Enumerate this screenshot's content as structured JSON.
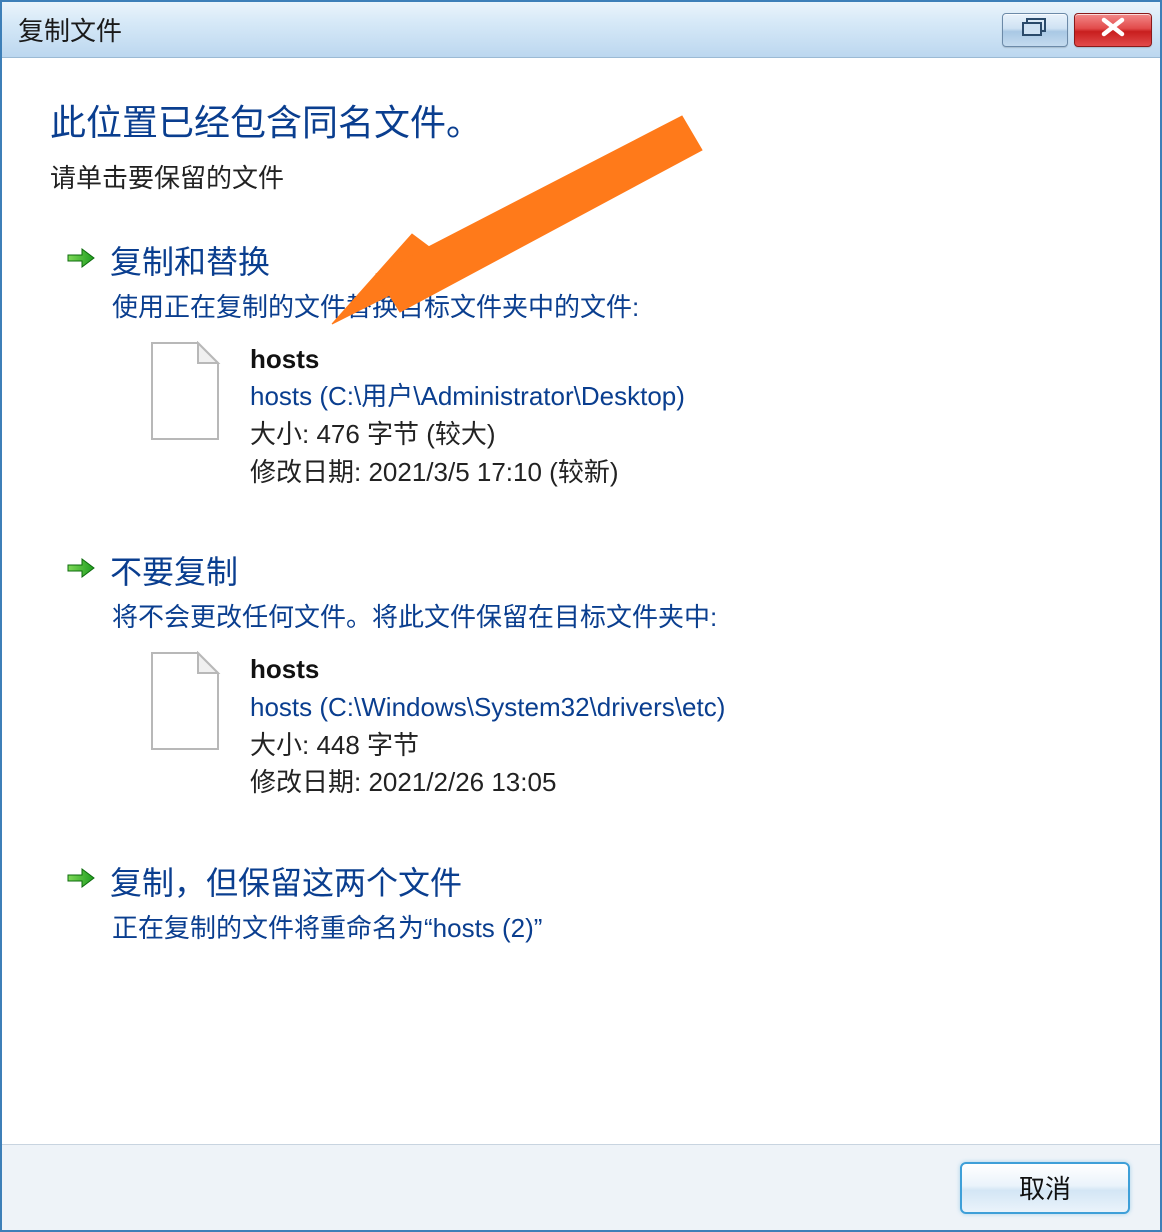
{
  "window": {
    "title": "复制文件"
  },
  "heading": "此位置已经包含同名文件。",
  "subheading": "请单击要保留的文件",
  "options": {
    "replace": {
      "title": "复制和替换",
      "desc": "使用正在复制的文件替换目标文件夹中的文件:",
      "file": {
        "name": "hosts",
        "path": "hosts (C:\\用户\\Administrator\\Desktop)",
        "size": "大小: 476 字节 (较大)",
        "modified": "修改日期: 2021/3/5 17:10 (较新)"
      }
    },
    "skip": {
      "title": "不要复制",
      "desc": "将不会更改任何文件。将此文件保留在目标文件夹中:",
      "file": {
        "name": "hosts",
        "path": "hosts (C:\\Windows\\System32\\drivers\\etc)",
        "size": "大小: 448 字节",
        "modified": "修改日期: 2021/2/26 13:05"
      }
    },
    "keepboth": {
      "title": "复制，但保留这两个文件",
      "desc": "正在复制的文件将重命名为“hosts (2)”"
    }
  },
  "footer": {
    "cancel": "取消"
  }
}
